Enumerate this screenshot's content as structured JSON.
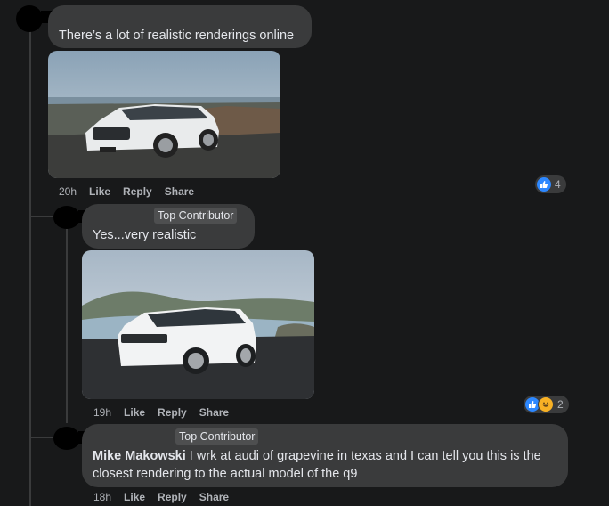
{
  "comments": [
    {
      "text": "There’s a lot of realistic renderings online",
      "time": "20h",
      "actions": [
        "Like",
        "Reply",
        "Share"
      ],
      "reaction_count": "4",
      "image_alt": "White SUV rendering on a coastal road"
    },
    {
      "badge": "Top Contributor",
      "text": "Yes...very realistic",
      "time": "19h",
      "actions": [
        "Like",
        "Reply",
        "Share"
      ],
      "reaction_count": "2",
      "image_alt": "White Volkswagen Atlas SUV by the water"
    },
    {
      "badge": "Top Contributor",
      "author": "Mike Makowski",
      "text": " I wrk at audi of grapevine in texas and I can tell you this is the closest rendering to the actual model of the q9",
      "time": "18h",
      "actions": [
        "Like",
        "Reply",
        "Share"
      ]
    }
  ],
  "colors": {
    "background": "#18191a",
    "bubble": "#3a3b3c",
    "like_blue": "#2d88ff",
    "haha_yellow": "#f7b125"
  }
}
